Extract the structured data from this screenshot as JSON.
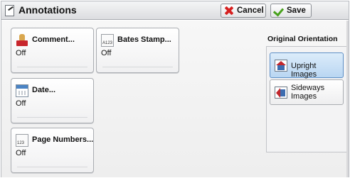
{
  "header": {
    "title": "Annotations",
    "cancel_label": "Cancel",
    "save_label": "Save"
  },
  "features": [
    {
      "name": "Comment...",
      "value": "Off"
    },
    {
      "name": "Bates Stamp...",
      "value": "Off",
      "icon_text": "A123"
    },
    {
      "name": "Date...",
      "value": "Off"
    },
    {
      "name": "Page Numbers...",
      "value": "Off",
      "icon_text": "123"
    }
  ],
  "orientation": {
    "label": "Original Orientation",
    "options": [
      {
        "label": "Upright Images",
        "selected": true
      },
      {
        "label": "Sideways Images",
        "selected": false
      }
    ]
  },
  "colors": {
    "selected_option": "#b9d6f2",
    "cancel_icon": "#d62020",
    "save_icon": "#48a11c"
  },
  "icons": {
    "title": "pen-icon",
    "cancel": "x-icon",
    "save": "check-icon",
    "comment": "stamp-icon",
    "bates": "page-icon",
    "date": "calendar-icon",
    "page_numbers": "page-icon",
    "upright": "house-upright-icon",
    "sideways": "house-sideways-icon"
  }
}
